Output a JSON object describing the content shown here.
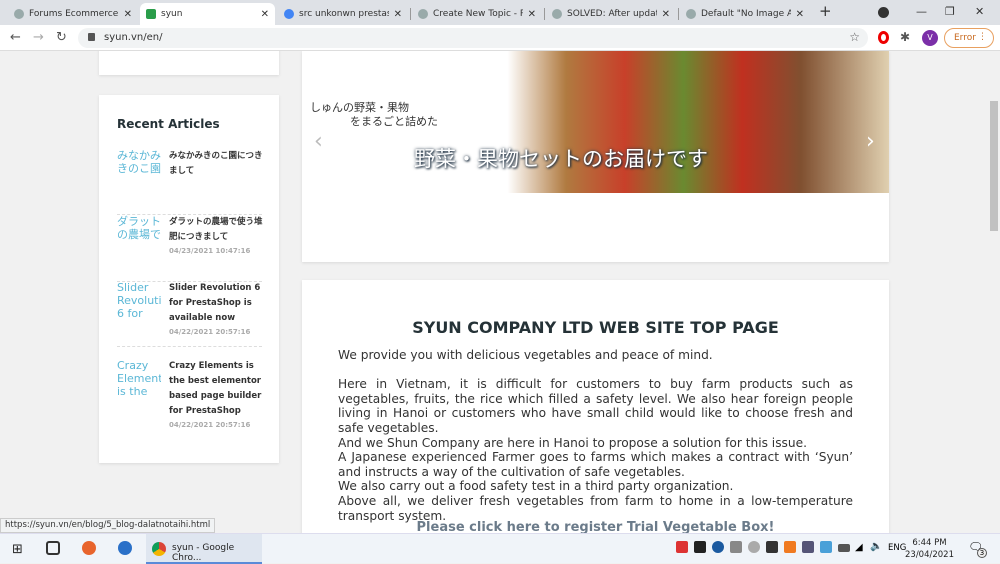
{
  "browser": {
    "tabs": [
      {
        "title": "Forums Ecommerce - I",
        "active": false
      },
      {
        "title": "syun",
        "active": true
      },
      {
        "title": "src unkonwn prestashop",
        "active": false
      },
      {
        "title": "Create New Topic - Pr",
        "active": false
      },
      {
        "title": "SOLVED: After update",
        "active": false
      },
      {
        "title": "Default \"No Image Av",
        "active": false
      }
    ],
    "new_tab": "+",
    "url": "syun.vn/en/",
    "profile_initial": "V",
    "error_label": "Error",
    "status_url": "https://syun.vn/en/blog/5_blog-dalatnotaihi.html"
  },
  "sidebar": {
    "title": "Recent Articles",
    "articles": [
      {
        "alt": "みなかみきのこ園",
        "title": "みなかみきのこ園につきまして",
        "date": ""
      },
      {
        "alt": "ダラットの農場で",
        "title": "ダラットの農場で使う堆肥につきまして",
        "date": "04/23/2021 10:47:16"
      },
      {
        "alt": "Slider Revolution 6 for",
        "title": "Slider Revolution 6 for PrestaShop is available now",
        "date": "04/22/2021 20:57:16"
      },
      {
        "alt": "Crazy Elements is the",
        "title": "Crazy Elements is the best elementor based page builder for PrestaShop",
        "date": "04/22/2021 20:57:16"
      }
    ]
  },
  "slider": {
    "line1": "しゅんの野菜・果物",
    "line2": "をまるごと詰めた",
    "headline": "野菜・果物セットのお届けです",
    "prev": "‹",
    "next": "›"
  },
  "main": {
    "heading": "SYUN COMPANY LTD WEB SITE TOP PAGE",
    "intro": "We provide you with delicious vegetables and peace of mind.",
    "paragraphs": [
      "Here in Vietnam, it is difficult for customers to buy farm products such as vegetables, fruits, the rice which filled a safety level. We also hear foreign people living in Hanoi or customers who have small child would like to choose fresh and safe vegetables.",
      "And we Shun Company are here in Hanoi to propose a solution for this issue.",
      "A Japanese experienced Farmer goes to farms which makes a contract with ‘Syun’ and instructs a way of the cultivation of safe vegetables.",
      "We also carry out a food safety test in a third party organization.",
      "Above all, we deliver fresh vegetables from farm to home in a low-temperature transport system."
    ],
    "cta": "Please click here to register Trial Vegetable Box!"
  },
  "taskbar": {
    "app_label": "syun - Google Chro...",
    "lang": "ENG",
    "time": "6:44 PM",
    "date": "23/04/2021",
    "notifications": "3"
  }
}
